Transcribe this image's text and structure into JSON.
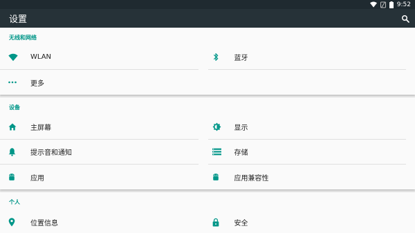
{
  "status_bar": {
    "time": "9:52"
  },
  "app_bar": {
    "title": "设置"
  },
  "sections": [
    {
      "header": "无线和网络",
      "tiles": [
        {
          "label": "WLAN",
          "icon": "wifi-icon"
        },
        {
          "label": "蓝牙",
          "icon": "bluetooth-icon"
        },
        {
          "label": "更多",
          "icon": "more-dots-icon"
        }
      ]
    },
    {
      "header": "设备",
      "tiles": [
        {
          "label": "主屏幕",
          "icon": "home-icon"
        },
        {
          "label": "显示",
          "icon": "brightness-icon"
        },
        {
          "label": "提示音和通知",
          "icon": "bell-icon"
        },
        {
          "label": "存储",
          "icon": "storage-icon"
        },
        {
          "label": "应用",
          "icon": "android-icon"
        },
        {
          "label": "应用兼容性",
          "icon": "android-icon"
        }
      ]
    },
    {
      "header": "个人",
      "tiles": [
        {
          "label": "位置信息",
          "icon": "location-pin-icon"
        },
        {
          "label": "安全",
          "icon": "lock-icon"
        }
      ]
    }
  ],
  "colors": {
    "accent": "#009688",
    "app_bar": "#263238",
    "status_bar": "#1f2a30"
  }
}
